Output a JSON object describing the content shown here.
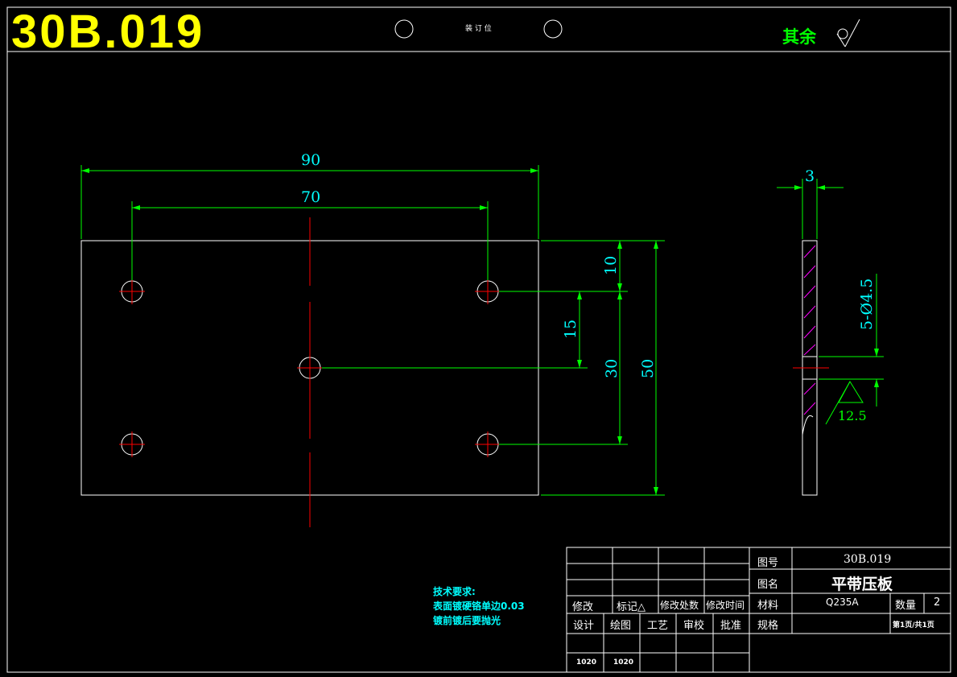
{
  "header": {
    "drawing_code": "30B.019",
    "binding_label": "装 订 位",
    "rest_label": "其余"
  },
  "dimensions": {
    "d90": "90",
    "d70": "70",
    "d10": "10",
    "d15": "15",
    "d30": "30",
    "d50": "50",
    "d3": "3",
    "hole": "5-Ø4.5",
    "roughness": "12.5"
  },
  "tech_requirements": {
    "title": "技术要求:",
    "line1": "表面镀硬铬单边0.03",
    "line2": "镀前镀后要抛光"
  },
  "title_block": {
    "revision_labels": [
      "修改",
      "标记△",
      "修改处数",
      "修改时间"
    ],
    "sign_labels": [
      "设计",
      "绘图",
      "工艺",
      "审校",
      "批准"
    ],
    "sign_dates": [
      "1020",
      "1020"
    ],
    "drawing_no_label": "图号",
    "drawing_no": "30B.019",
    "name_label": "图名",
    "name": "平带压板",
    "material_label": "材料",
    "material": "Q235A",
    "qty_label": "数量",
    "qty": "2",
    "spec_label": "规格",
    "page": "第1页/共1页"
  },
  "colors": {
    "outline": "#ffffff",
    "dimension": "#00ff00",
    "dim_text": "#00ffff",
    "center": "#ff0000",
    "hatch": "#ff00ff",
    "title": "#ffff00"
  }
}
